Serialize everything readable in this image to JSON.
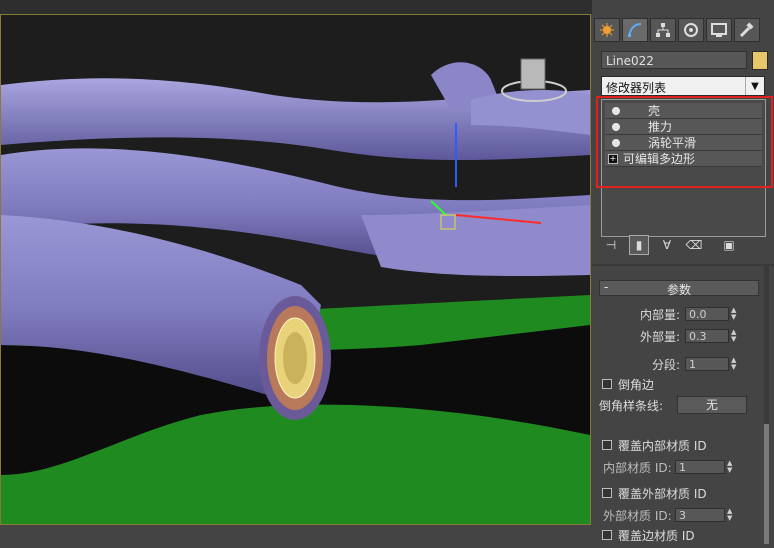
{
  "tabs": [
    {
      "name": "create-tab-icon"
    },
    {
      "name": "modify-tab-icon"
    },
    {
      "name": "hierarchy-tab-icon"
    },
    {
      "name": "motion-tab-icon"
    },
    {
      "name": "display-tab-icon"
    },
    {
      "name": "utilities-tab-icon"
    }
  ],
  "object": {
    "name": "Line022",
    "color": "#e8c76a"
  },
  "modifier_list": {
    "label": "修改器列表"
  },
  "stack": {
    "items": [
      {
        "label": "壳"
      },
      {
        "label": "推力"
      },
      {
        "label": "涡轮平滑"
      },
      {
        "label": "可编辑多边形"
      }
    ]
  },
  "params": {
    "title": "参数",
    "inner_amount": {
      "label": "内部量:",
      "value": "0.0"
    },
    "outer_amount": {
      "label": "外部量:",
      "value": "0.3"
    },
    "segments": {
      "label": "分段:",
      "value": "1"
    },
    "bevel_edges": {
      "label": "倒角边"
    },
    "bevel_spline": {
      "label": "倒角样条线:",
      "value": "无"
    },
    "override_inner_mat": {
      "label": "覆盖内部材质 ID"
    },
    "inner_mat_id": {
      "label": "内部材质 ID:",
      "value": "1"
    },
    "override_outer_mat": {
      "label": "覆盖外部材质 ID"
    },
    "outer_mat_id": {
      "label": "外部材质 ID:",
      "value": "3"
    },
    "override_edge_mat": {
      "label": "覆盖边材质 ID"
    }
  },
  "colors": {
    "highlight_box": "#e0221e",
    "ground": "#1f8a1f",
    "tubes": "#8a86c8"
  }
}
